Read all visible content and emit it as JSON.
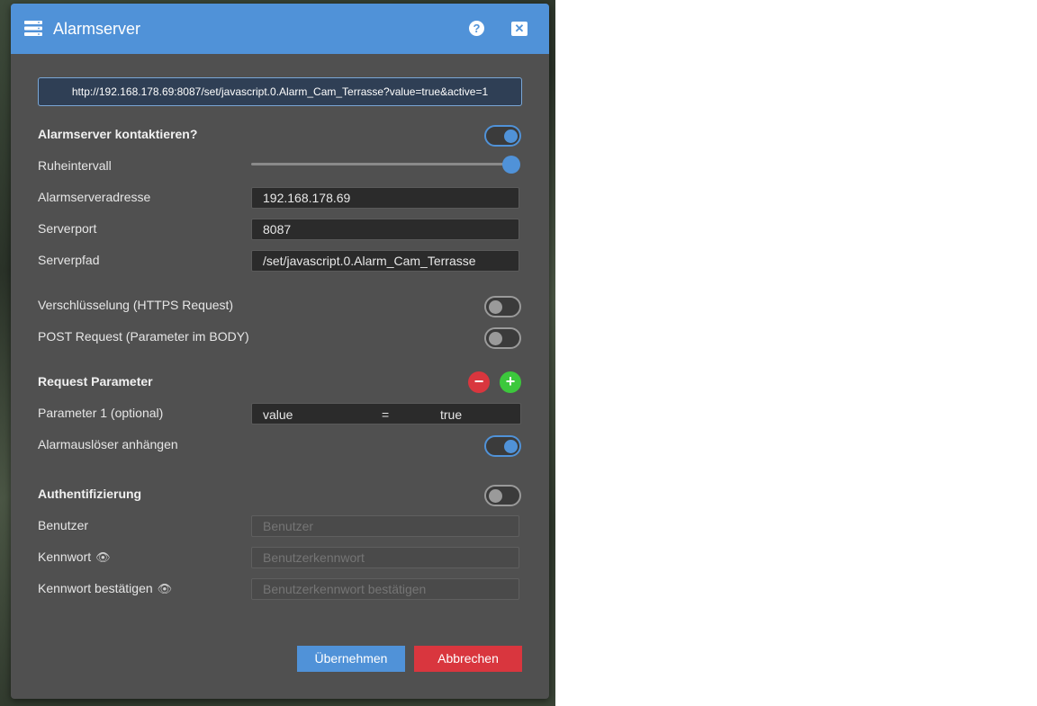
{
  "window": {
    "title": "Alarmserver",
    "help_label": "?",
    "close_label": "✕",
    "icon": "server-icon"
  },
  "url_preview": "http://192.168.178.69:8087/set/javascript.0.Alarm_Cam_Terrasse?value=true&active=1",
  "contact": {
    "label": "Alarmserver kontaktieren?",
    "enabled": true
  },
  "rest_interval": {
    "label": "Ruheintervall",
    "level_fraction": 1.0
  },
  "address": {
    "label": "Alarmserveradresse",
    "value": "192.168.178.69"
  },
  "port": {
    "label": "Serverport",
    "value": "8087"
  },
  "path": {
    "label": "Serverpfad",
    "value": "/set/javascript.0.Alarm_Cam_Terrasse"
  },
  "https": {
    "label": "Verschlüsselung (HTTPS Request)",
    "enabled": false
  },
  "post": {
    "label": "POST Request (Parameter im BODY)",
    "enabled": false
  },
  "request_params": {
    "label": "Request Parameter",
    "remove_label": "−",
    "add_label": "+",
    "param1_label": "Parameter 1 (optional)",
    "param1_key": "value",
    "param1_eq": "=",
    "param1_value": "true"
  },
  "trigger": {
    "label": "Alarmauslöser anhängen",
    "enabled": true
  },
  "auth": {
    "label": "Authentifizierung",
    "enabled": false
  },
  "user": {
    "label": "Benutzer",
    "placeholder": "Benutzer"
  },
  "password": {
    "label": "Kennwort",
    "placeholder": "Benutzerkennwort"
  },
  "password_confirm": {
    "label": "Kennwort bestätigen",
    "placeholder": "Benutzerkennwort bestätigen"
  },
  "eye_glyph": "👁",
  "actions": {
    "apply_label": "Übernehmen",
    "cancel_label": "Abbrechen"
  },
  "colors": {
    "accent": "#5092d8",
    "danger": "#d9363e",
    "success": "#3cc83c"
  }
}
